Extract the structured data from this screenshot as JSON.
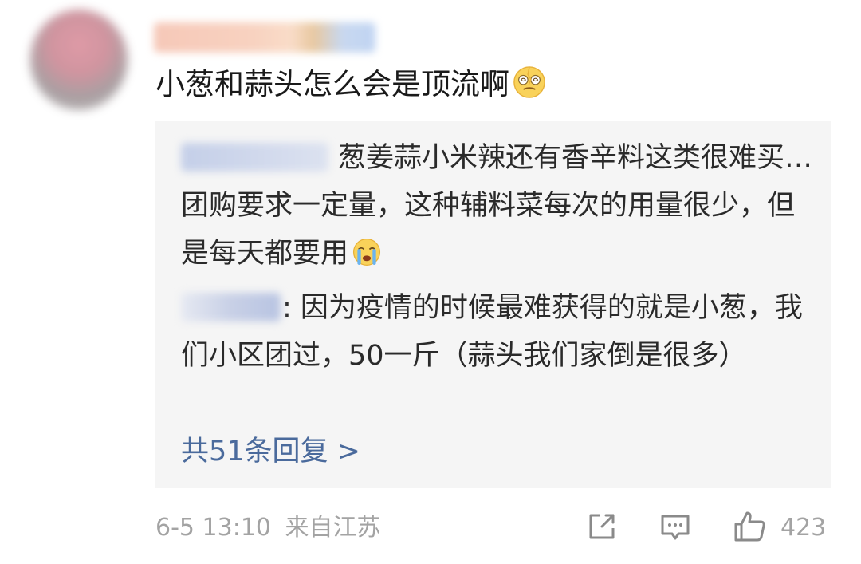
{
  "comment": {
    "text": "小葱和蒜头怎么会是顶流啊"
  },
  "replies": [
    {
      "text": "葱姜蒜小米辣还有香辛料这类很难买…团购要求一定量，这种辅料菜每次的用量很少，但是每天都要用"
    },
    {
      "text": ": 因为疫情的时候最难获得的就是小葱，我们小区团过，50一斤（蒜头我们家倒是很多）"
    }
  ],
  "more_replies": "共51条回复 >",
  "footer": {
    "timestamp": "6-5 13:10",
    "location": "来自江苏",
    "like_count": "423"
  },
  "icons": {
    "emoji_1": "dizzy-face-emoji",
    "emoji_2": "crying-face-emoji",
    "share": "share-icon",
    "comment": "comment-icon",
    "like": "thumbs-up-icon"
  },
  "colors": {
    "link": "#4a6a9c",
    "meta": "#a3a3a3",
    "reply_bg": "#f5f5f5"
  }
}
